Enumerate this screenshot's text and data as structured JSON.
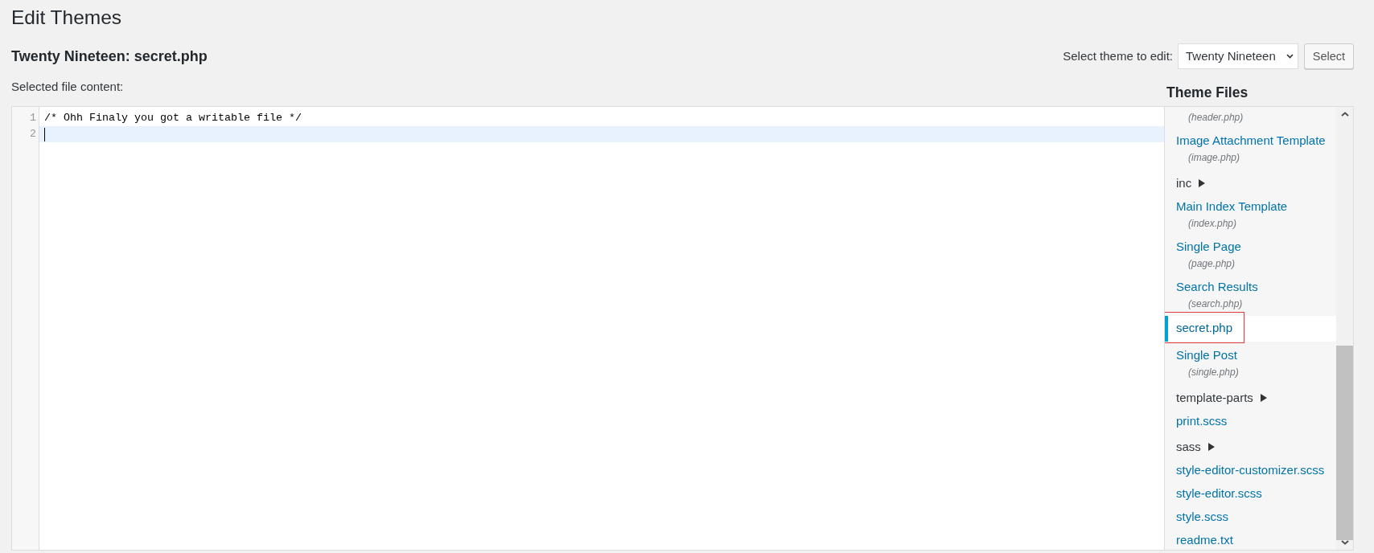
{
  "page_title": "Edit Themes",
  "file_title": "Twenty Nineteen: secret.php",
  "theme_picker": {
    "label": "Select theme to edit:",
    "value": "Twenty Nineteen",
    "button": "Select"
  },
  "editor": {
    "label": "Selected file content:",
    "lines": [
      {
        "number": "1",
        "text": "/* Ohh Finaly you got a writable file */",
        "active": false
      },
      {
        "number": "2",
        "active": true
      }
    ]
  },
  "theme_files": {
    "title": "Theme Files",
    "items": [
      {
        "kind": "file",
        "description": "(header.php)",
        "selected": false,
        "highlighted": false
      },
      {
        "kind": "file",
        "name": "Image Attachment Template",
        "description": "(image.php)",
        "selected": false,
        "highlighted": false
      },
      {
        "kind": "folder",
        "name": "inc",
        "expanded": false,
        "selected": false,
        "highlighted": false
      },
      {
        "kind": "file",
        "name": "Main Index Template",
        "description": "(index.php)",
        "selected": false,
        "highlighted": false
      },
      {
        "kind": "file",
        "name": "Single Page",
        "description": "(page.php)",
        "selected": false,
        "highlighted": false
      },
      {
        "kind": "file",
        "name": "Search Results",
        "description": "(search.php)",
        "selected": false,
        "highlighted": false
      },
      {
        "kind": "file",
        "name": "secret.php",
        "selected": true,
        "highlighted": true
      },
      {
        "kind": "file",
        "name": "Single Post",
        "description": "(single.php)",
        "selected": false,
        "highlighted": false
      },
      {
        "kind": "folder",
        "name": "template-parts",
        "expanded": false,
        "selected": false,
        "highlighted": false
      },
      {
        "kind": "file",
        "name": "print.scss",
        "selected": false,
        "highlighted": false
      },
      {
        "kind": "folder",
        "name": "sass",
        "expanded": false,
        "selected": false,
        "highlighted": false
      },
      {
        "kind": "file",
        "name": "style-editor-customizer.scss",
        "selected": false,
        "highlighted": false
      },
      {
        "kind": "file",
        "name": "style-editor.scss",
        "selected": false,
        "highlighted": false
      },
      {
        "kind": "file",
        "name": "style.scss",
        "selected": false,
        "highlighted": false
      },
      {
        "kind": "file",
        "name": "readme.txt",
        "selected": false,
        "highlighted": false
      }
    ]
  }
}
